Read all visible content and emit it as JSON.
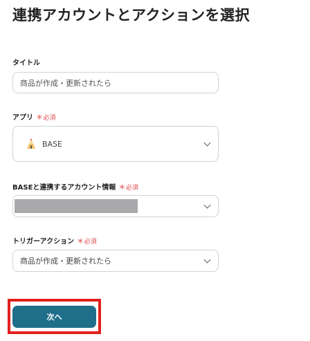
{
  "page_title": "連携アカウントとアクションを選択",
  "required_mark": "＊",
  "required_label": "必須",
  "title_field": {
    "label": "タイトル",
    "value": "商品が作成・更新されたら"
  },
  "app_field": {
    "label": "アプリ",
    "selected": "BASE",
    "icon": "base-logo-icon"
  },
  "account_field": {
    "label": "BASEと連携するアカウント情報"
  },
  "trigger_field": {
    "label": "トリガーアクション",
    "selected": "商品が作成・更新されたら"
  },
  "next_button_label": "次へ",
  "colors": {
    "primary_button": "#1f6f8b",
    "highlight_border": "#e1201d",
    "required": "#e04a4a"
  }
}
